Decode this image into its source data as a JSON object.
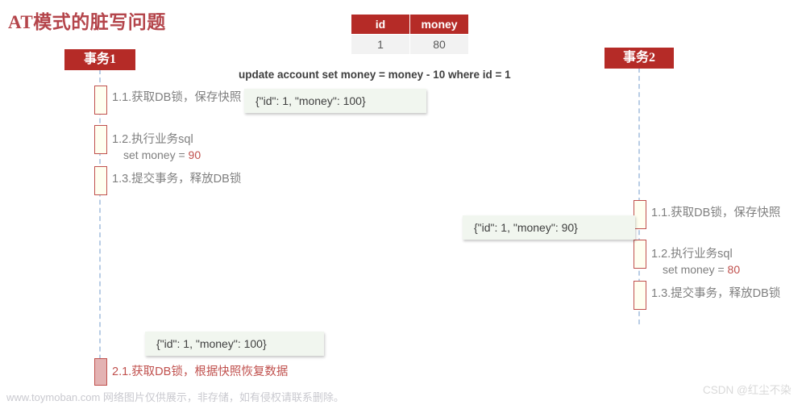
{
  "title": "AT模式的脏写问题",
  "table": {
    "headers": [
      "id",
      "money"
    ],
    "rows": [
      [
        "1",
        "80"
      ]
    ]
  },
  "sql": "update account set money = money - 10 where id = 1",
  "participants": [
    {
      "name": "事务1"
    },
    {
      "name": "事务2"
    }
  ],
  "tx1_steps": [
    {
      "label": "1.1.获取DB锁，保存快照",
      "sub": "",
      "val": ""
    },
    {
      "label": "1.2.执行业务sql",
      "sub": "set money = ",
      "val": "90"
    },
    {
      "label": "1.3.提交事务，释放DB锁",
      "sub": "",
      "val": ""
    },
    {
      "label": "2.1.获取DB锁，根据快照恢复数据",
      "sub": "",
      "val": ""
    }
  ],
  "tx2_steps": [
    {
      "label": "1.1.获取DB锁，保存快照",
      "sub": "",
      "val": ""
    },
    {
      "label": "1.2.执行业务sql",
      "sub": "set money = ",
      "val": "80"
    },
    {
      "label": "1.3.提交事务，释放DB锁",
      "sub": "",
      "val": ""
    }
  ],
  "notes": [
    {
      "text": "{\"id\": 1, \"money\": 100}"
    },
    {
      "text": "{\"id\": 1, \"money\": 90}"
    },
    {
      "text": "{\"id\": 1, \"money\": 100}"
    }
  ],
  "watermarks": {
    "bottom_left": "www.toymoban.com 网络图片仅供展示，非存储，如有侵权请联系删除。",
    "bottom_right": "CSDN @红尘不染"
  },
  "colors": {
    "brand_red": "#b52b27",
    "title_red": "#b4454b",
    "accent_red": "#c0504d",
    "lifeline_blue": "#b9cde5",
    "note_green": "#f1f6ef",
    "activation_cream": "#fffff0",
    "activation_rose": "#e3b2b2"
  }
}
